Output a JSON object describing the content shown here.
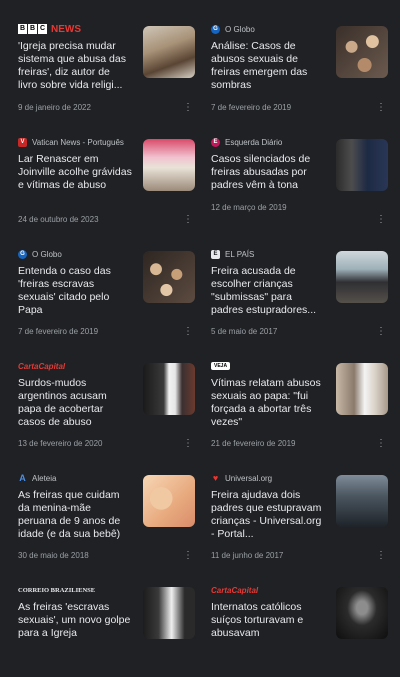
{
  "colors": {
    "background": "#202124",
    "title": "#e8eaed",
    "meta": "#9aa0a6",
    "bbc_red": "#e53935"
  },
  "articles": [
    {
      "source": "NEWS",
      "source_prefix": "BBC",
      "source_icon": "bbc-logo",
      "title": "'Igreja precisa mudar sistema que abusa das freiras', diz autor de livro sobre vida religi...",
      "date": "9 de janeiro de 2022",
      "thumb": "hands-book-photo"
    },
    {
      "source": "O Globo",
      "source_icon": "globo-icon",
      "title": "Análise: Casos de abusos sexuais de freiras emergem das sombras",
      "date": "7 de fevereiro de 2019",
      "thumb": "crowd-photo"
    },
    {
      "source": "Vatican News - Português",
      "source_icon": "vatican-icon",
      "title": "Lar Renascer em Joinville acolhe grávidas e vítimas de abuso",
      "date": "24 de outubro de 2023",
      "thumb": "group-photo"
    },
    {
      "source": "Esquerda Diário",
      "source_icon": "esquerda-icon",
      "title": "Casos silenciados de freiras abusadas por padres vêm à tona",
      "date": "12 de março de 2019",
      "thumb": "nuns-photo"
    },
    {
      "source": "O Globo",
      "source_icon": "globo-icon",
      "title": "Entenda o caso das 'freiras escravas sexuais' citado pelo Papa",
      "date": "7 de fevereiro de 2019",
      "thumb": "crowd-photo-2"
    },
    {
      "source": "EL PAÍS",
      "source_icon": "elpais-icon",
      "title": "Freira acusada de escolher crianças \"submissas\" para padres estupradores...",
      "date": "5 de maio de 2017",
      "thumb": "nun-outdoor-photo"
    },
    {
      "source": "CartaCapital",
      "source_icon": "cartacapital-logo",
      "title": "Surdos-mudos argentinos acusam papa de acobertar casos de abuso",
      "date": "13 de fevereiro de 2020",
      "thumb": "pope-photo"
    },
    {
      "source": "VEJA",
      "source_icon": "veja-logo",
      "title": "Vítimas relatam abusos sexuais ao papa: \"fui forçada a abortar três vezes\"",
      "date": "21 de fevereiro de 2019",
      "thumb": "pope-seated-photo"
    },
    {
      "source": "Aleteia",
      "source_icon": "aleteia-icon",
      "title": "As freiras que cuidam da menina-mãe peruana de 9 anos de idade (e da sua bebê)",
      "date": "30 de maio de 2018",
      "thumb": "pregnant-photo"
    },
    {
      "source": "Universal.org",
      "source_icon": "universal-icon",
      "title": "Freira ajudava dois padres que estupravam crianças - Universal.org - Portal...",
      "date": "11 de junho de 2017",
      "thumb": "court-photo"
    },
    {
      "source": "CORREIO BRAZILIENSE",
      "source_icon": "correio-logo",
      "title": "As freiras 'escravas sexuais', um novo golpe para a Igreja",
      "date": "",
      "thumb": "nun-pope-photo"
    },
    {
      "source": "CartaCapital",
      "source_icon": "cartacapital-logo",
      "title": "Internatos católicos suíços torturavam e abusavam",
      "date": "",
      "thumb": "corridor-photo"
    }
  ]
}
